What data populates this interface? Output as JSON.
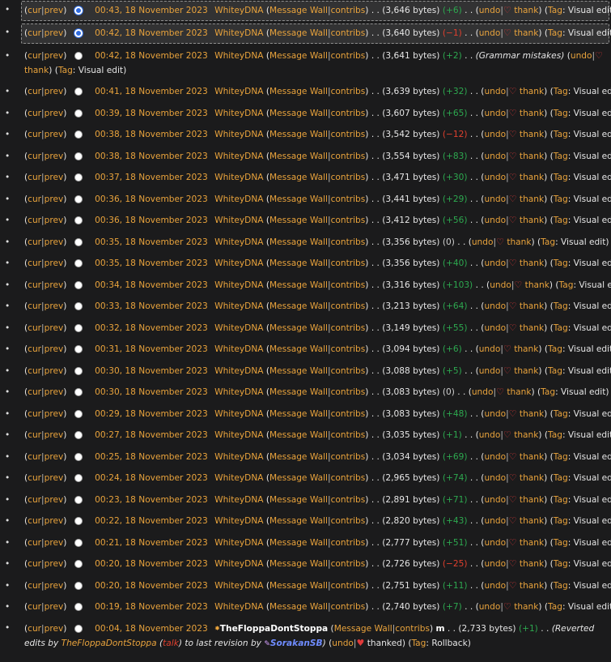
{
  "common": {
    "cur": "cur",
    "prev": "prev",
    "message_wall": "Message Wall",
    "contribs": "contribs",
    "undo": "undo",
    "thank": "thank",
    "tag_label": "Tag",
    "tag_visual": "Visual edit",
    "dots": ". ."
  },
  "revisions": [
    {
      "date": "00:43, 18 November 2023",
      "user": "WhiteyDNA",
      "bytes": "(3,646 bytes)",
      "diff": "(+6)",
      "sign": "pos",
      "selected": true
    },
    {
      "date": "00:42, 18 November 2023",
      "user": "WhiteyDNA",
      "bytes": "(3,640 bytes)",
      "diff": "(−1)",
      "sign": "neg",
      "selected": true
    },
    {
      "date": "00:42, 18 November 2023",
      "user": "WhiteyDNA",
      "bytes": "(3,641 bytes)",
      "diff": "(+2)",
      "sign": "pos",
      "summary": "(Grammar mistakes)"
    },
    {
      "date": "00:41, 18 November 2023",
      "user": "WhiteyDNA",
      "bytes": "(3,639 bytes)",
      "diff": "(+32)",
      "sign": "pos"
    },
    {
      "date": "00:39, 18 November 2023",
      "user": "WhiteyDNA",
      "bytes": "(3,607 bytes)",
      "diff": "(+65)",
      "sign": "pos"
    },
    {
      "date": "00:38, 18 November 2023",
      "user": "WhiteyDNA",
      "bytes": "(3,542 bytes)",
      "diff": "(−12)",
      "sign": "neg"
    },
    {
      "date": "00:38, 18 November 2023",
      "user": "WhiteyDNA",
      "bytes": "(3,554 bytes)",
      "diff": "(+83)",
      "sign": "pos"
    },
    {
      "date": "00:37, 18 November 2023",
      "user": "WhiteyDNA",
      "bytes": "(3,471 bytes)",
      "diff": "(+30)",
      "sign": "pos"
    },
    {
      "date": "00:36, 18 November 2023",
      "user": "WhiteyDNA",
      "bytes": "(3,441 bytes)",
      "diff": "(+29)",
      "sign": "pos"
    },
    {
      "date": "00:36, 18 November 2023",
      "user": "WhiteyDNA",
      "bytes": "(3,412 bytes)",
      "diff": "(+56)",
      "sign": "pos"
    },
    {
      "date": "00:35, 18 November 2023",
      "user": "WhiteyDNA",
      "bytes": "(3,356 bytes)",
      "diff": "(0)",
      "sign": "zero"
    },
    {
      "date": "00:35, 18 November 2023",
      "user": "WhiteyDNA",
      "bytes": "(3,356 bytes)",
      "diff": "(+40)",
      "sign": "pos"
    },
    {
      "date": "00:34, 18 November 2023",
      "user": "WhiteyDNA",
      "bytes": "(3,316 bytes)",
      "diff": "(+103)",
      "sign": "pos"
    },
    {
      "date": "00:33, 18 November 2023",
      "user": "WhiteyDNA",
      "bytes": "(3,213 bytes)",
      "diff": "(+64)",
      "sign": "pos"
    },
    {
      "date": "00:32, 18 November 2023",
      "user": "WhiteyDNA",
      "bytes": "(3,149 bytes)",
      "diff": "(+55)",
      "sign": "pos"
    },
    {
      "date": "00:31, 18 November 2023",
      "user": "WhiteyDNA",
      "bytes": "(3,094 bytes)",
      "diff": "(+6)",
      "sign": "pos"
    },
    {
      "date": "00:30, 18 November 2023",
      "user": "WhiteyDNA",
      "bytes": "(3,088 bytes)",
      "diff": "(+5)",
      "sign": "pos"
    },
    {
      "date": "00:30, 18 November 2023",
      "user": "WhiteyDNA",
      "bytes": "(3,083 bytes)",
      "diff": "(0)",
      "sign": "zero"
    },
    {
      "date": "00:29, 18 November 2023",
      "user": "WhiteyDNA",
      "bytes": "(3,083 bytes)",
      "diff": "(+48)",
      "sign": "pos"
    },
    {
      "date": "00:27, 18 November 2023",
      "user": "WhiteyDNA",
      "bytes": "(3,035 bytes)",
      "diff": "(+1)",
      "sign": "pos"
    },
    {
      "date": "00:25, 18 November 2023",
      "user": "WhiteyDNA",
      "bytes": "(3,034 bytes)",
      "diff": "(+69)",
      "sign": "pos"
    },
    {
      "date": "00:24, 18 November 2023",
      "user": "WhiteyDNA",
      "bytes": "(2,965 bytes)",
      "diff": "(+74)",
      "sign": "pos"
    },
    {
      "date": "00:23, 18 November 2023",
      "user": "WhiteyDNA",
      "bytes": "(2,891 bytes)",
      "diff": "(+71)",
      "sign": "pos"
    },
    {
      "date": "00:22, 18 November 2023",
      "user": "WhiteyDNA",
      "bytes": "(2,820 bytes)",
      "diff": "(+43)",
      "sign": "pos"
    },
    {
      "date": "00:21, 18 November 2023",
      "user": "WhiteyDNA",
      "bytes": "(2,777 bytes)",
      "diff": "(+51)",
      "sign": "pos"
    },
    {
      "date": "00:20, 18 November 2023",
      "user": "WhiteyDNA",
      "bytes": "(2,726 bytes)",
      "diff": "(−25)",
      "sign": "neg"
    },
    {
      "date": "00:20, 18 November 2023",
      "user": "WhiteyDNA",
      "bytes": "(2,751 bytes)",
      "diff": "(+11)",
      "sign": "pos"
    },
    {
      "date": "00:19, 18 November 2023",
      "user": "WhiteyDNA",
      "bytes": "(2,740 bytes)",
      "diff": "(+7)",
      "sign": "pos"
    }
  ],
  "last": {
    "date": "00:04, 18 November 2023",
    "user": "TheFloppaDontStoppa",
    "minor": "m",
    "bytes": "(2,733 bytes)",
    "diff": "(+1)",
    "summary_start": "(Reverted edits by",
    "summary_user": "TheFloppaDontStoppa",
    "talk": "talk",
    "summary_mid": "to last revision by",
    "summary_user2": "SorakanSB",
    "thanked": "thanked",
    "tag_value": "Rollback",
    "colors": {
      "positive": "#2da84f",
      "negative": "#e0402e",
      "link": "#e9a33c"
    }
  }
}
